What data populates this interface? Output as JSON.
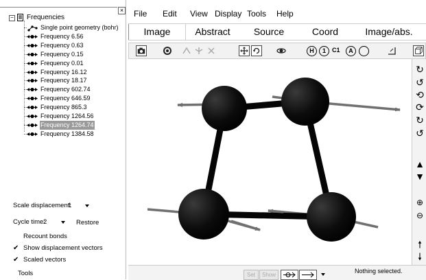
{
  "tree": {
    "root_label": "Frequencies",
    "items": [
      {
        "label": "Single point geometry (bohr)",
        "kind": "geometry",
        "selected": false
      },
      {
        "label": "Frequency 6.56",
        "kind": "frequency",
        "selected": false
      },
      {
        "label": "Frequency 0.63",
        "kind": "frequency",
        "selected": false
      },
      {
        "label": "Frequency 0.15",
        "kind": "frequency",
        "selected": false
      },
      {
        "label": "Frequency 0.01",
        "kind": "frequency",
        "selected": false
      },
      {
        "label": "Frequency 16.12",
        "kind": "frequency",
        "selected": false
      },
      {
        "label": "Frequency 18.17",
        "kind": "frequency",
        "selected": false
      },
      {
        "label": "Frequency 602.74",
        "kind": "frequency",
        "selected": false
      },
      {
        "label": "Frequency 646.59",
        "kind": "frequency",
        "selected": false
      },
      {
        "label": "Frequency 865.3",
        "kind": "frequency",
        "selected": false
      },
      {
        "label": "Frequency 1264.56",
        "kind": "frequency",
        "selected": false
      },
      {
        "label": "Frequency 1264.74",
        "kind": "frequency",
        "selected": true
      },
      {
        "label": "Frequency 1384.58",
        "kind": "frequency",
        "selected": false
      }
    ]
  },
  "options": {
    "scale_label": "Scale displacement:",
    "scale_value": "1",
    "cycle_label": "Cycle time:",
    "cycle_value": "2",
    "restore_label": "Restore",
    "recount_label": "Recount bonds",
    "show_vectors_label": "Show displacement vectors",
    "show_vectors_checked": true,
    "scaled_vectors_label": "Scaled vectors",
    "scaled_vectors_checked": true,
    "tools_label": "Tools"
  },
  "menu": [
    "File",
    "Edit",
    "View",
    "Display",
    "Tools",
    "Help"
  ],
  "tabs": [
    {
      "label": "Image",
      "active": true
    },
    {
      "label": "Abstract",
      "active": false
    },
    {
      "label": "Source",
      "active": false
    },
    {
      "label": "Coord",
      "active": false
    },
    {
      "label": "Image/abs.",
      "active": false
    }
  ],
  "toolbar_labels": {
    "c1": "C1",
    "h": "H",
    "one": "1",
    "a": "A"
  },
  "bottom": {
    "set_label": "Set",
    "show_label": "Show",
    "status": "Nothing selected."
  },
  "icons": {
    "toolbar": [
      "camera-icon",
      "rotate-molecule-icon",
      "add-atom-icon",
      "add-bond-icon",
      "delete-icon",
      "move-icon",
      "rotate-icon",
      "orbit-icon",
      "h-toggle-icon",
      "one-toggle-icon",
      "c1-icon",
      "a-toggle-icon",
      "circle-icon",
      "measure-icon",
      "box-icon"
    ],
    "right": [
      "rotate-x-pos-icon",
      "rotate-x-neg-icon",
      "rotate-y-pos-icon",
      "rotate-y-neg-icon",
      "rotate-z-pos-icon",
      "rotate-z-neg-icon",
      "move-up-icon",
      "move-down-icon",
      "zoom-in-icon",
      "zoom-out-icon",
      "translate-up-icon",
      "translate-down-icon"
    ]
  },
  "colors": {
    "atom": "#0a0a0a",
    "vector": "#707070",
    "selection": "#9a9a9a"
  }
}
